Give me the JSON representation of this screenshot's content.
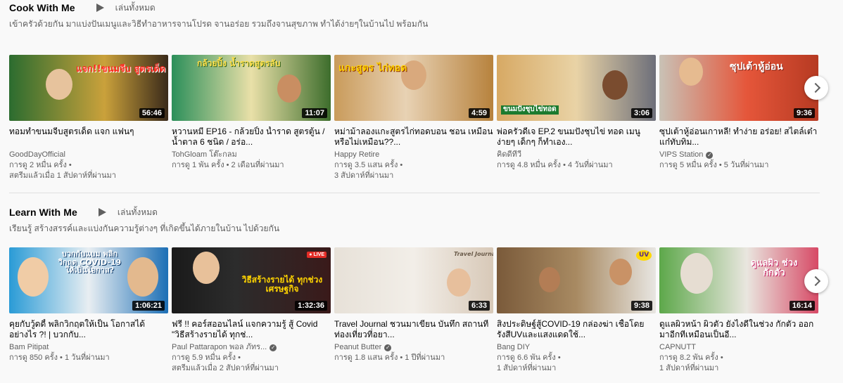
{
  "shelves": [
    {
      "title": "Cook With Me",
      "play_all": "เล่นทั้งหมด",
      "description": "เข้าครัวด้วยกัน มาแบ่งปันเมนูและวิธีทำอาหารจานโปรด จานอร่อย รวมถึงจานสุขภาพ ทำได้ง่ายๆในบ้านไป พร้อมกัน",
      "videos": [
        {
          "title": "ทอมทำขนมจีบสูตรเด็ด แจก แฟนๆ",
          "channel": "GoodDayOfficial",
          "verified": false,
          "views": "การดู 2 หมื่น ครั้ง •",
          "age": "สตรีมแล้วเมื่อ 1 สัปดาห์ที่ผ่านมา",
          "duration": "56:46",
          "thumb_text": "แจก!!ขนมจีบ สูตรเด็ด จากทอม"
        },
        {
          "title": "หวานหมี EP16 - กล้วยปิ้ง น้ำราด สูตรตู้น / น้ำตาล 6 ชนิด / อร่อ...",
          "channel": "TohGloam โต๊ะกลม",
          "verified": false,
          "views": "การดู 1 พัน ครั้ง • 2 เดือนที่ผ่านมา",
          "age": "",
          "duration": "11:07",
          "thumb_text": "กล้วยปิ้ง น้ำราดสูตรลับ"
        },
        {
          "title": "หม่าม้าลองแกะสูตรไก่ทอดบอน ชอน เหมือนหรือไม่เหมือน??...",
          "channel": "Happy Retire",
          "verified": false,
          "views": "การดู 3.5 แสน ครั้ง •",
          "age": "3 สัปดาห์ที่ผ่านมา",
          "duration": "4:59",
          "thumb_text": "แกะสูตร ไก่ทอด"
        },
        {
          "title": "พ่อครัวดีเจ EP.2 ขนมปังชุบไข่ ทอด เมนูง่ายๆ เด็กๆ ก็ทำเอง...",
          "channel": "คิดดีทีวี",
          "verified": false,
          "views": "การดู 4.8 หมื่น ครั้ง • 4 วันที่ผ่านมา",
          "age": "",
          "duration": "3:06",
          "thumb_text": "ขนมปังชุบไข่ทอด"
        },
        {
          "title": "ซุปเต้าหู้อ่อนเกาหลี! ทำง่าย อร่อย! สไตล์เต๋าแก๋ทับทิม...",
          "channel": "VIPS Station",
          "verified": true,
          "views": "การดู 5 หมื่น ครั้ง • 5 วันที่ผ่านมา",
          "age": "",
          "duration": "9:36",
          "thumb_text": "ซุปเต้าหู้อ่อน"
        }
      ]
    },
    {
      "title": "Learn With Me",
      "play_all": "เล่นทั้งหมด",
      "description": "เรียนรู้ สร้างสรรค์และแบ่งกันความรู้ต่างๆ ที่เกิดขึ้นได้ภายในบ้าน ไปด้วยกัน",
      "videos": [
        {
          "title": "คุยกับวู้ดดี้ พลิกวิกฤตให้เป็น โอกาสได้อย่างไร ?! | บวกกับ...",
          "channel": "Bam Pitipat",
          "verified": false,
          "views": "การดู 850 ครั้ง • 1 วันที่ผ่านมา",
          "age": "",
          "duration": "1:06:21",
          "thumb_text": "บวกกับแบม พลิกวิกฤต COVID-19 ให้เป็นโอกาส?"
        },
        {
          "title": "ฟรี !! คอร์สออนไลน์ แจกความรู้ สู้ Covid \"วิธีสร้างรายได้ ทุกช่...",
          "channel": "Paul Pattarapon พอล ภัทร...",
          "verified": true,
          "views": "การดู 5.9 หมื่น ครั้ง •",
          "age": "สตรีมแล้วเมื่อ 2 สัปดาห์ที่ผ่านมา",
          "duration": "1:32:36",
          "thumb_text": "วิธีสร้างรายได้ ทุกช่วงเศรษฐกิจ"
        },
        {
          "title": "Travel Journal ชวนมาเขียน บันทึก สถานที่ท่องเที่ยวที่อยา...",
          "channel": "Peanut Butter",
          "verified": true,
          "views": "การดู 1.8 แสน ครั้ง • 1 ปีที่ผ่านมา",
          "age": "",
          "duration": "6:33",
          "thumb_text": "Travel Journal"
        },
        {
          "title": "สิ่งประดิษฐ์สู้COVID-19 กล่องฆ่า เชื้อโดยรังสีUVและแสงแดดใช้...",
          "channel": "Bang DIY",
          "verified": false,
          "views": "การดู 6.6 พัน ครั้ง •",
          "age": "1 สัปดาห์ที่ผ่านมา",
          "duration": "9:38",
          "thumb_text": "UV"
        },
        {
          "title": "ดูแลผิวหน้า ผิวตัว ยังไงดีในช่วง กักตัว ออกมาอีกทีเหมือนเป็นอี...",
          "channel": "CAPNUTT",
          "verified": false,
          "views": "การดู 8.2 พัน ครั้ง •",
          "age": "1 สัปดาห์ที่ผ่านมา",
          "duration": "16:14",
          "thumb_text": "ดูแลผิว ช่วงกักตัว"
        }
      ]
    }
  ]
}
